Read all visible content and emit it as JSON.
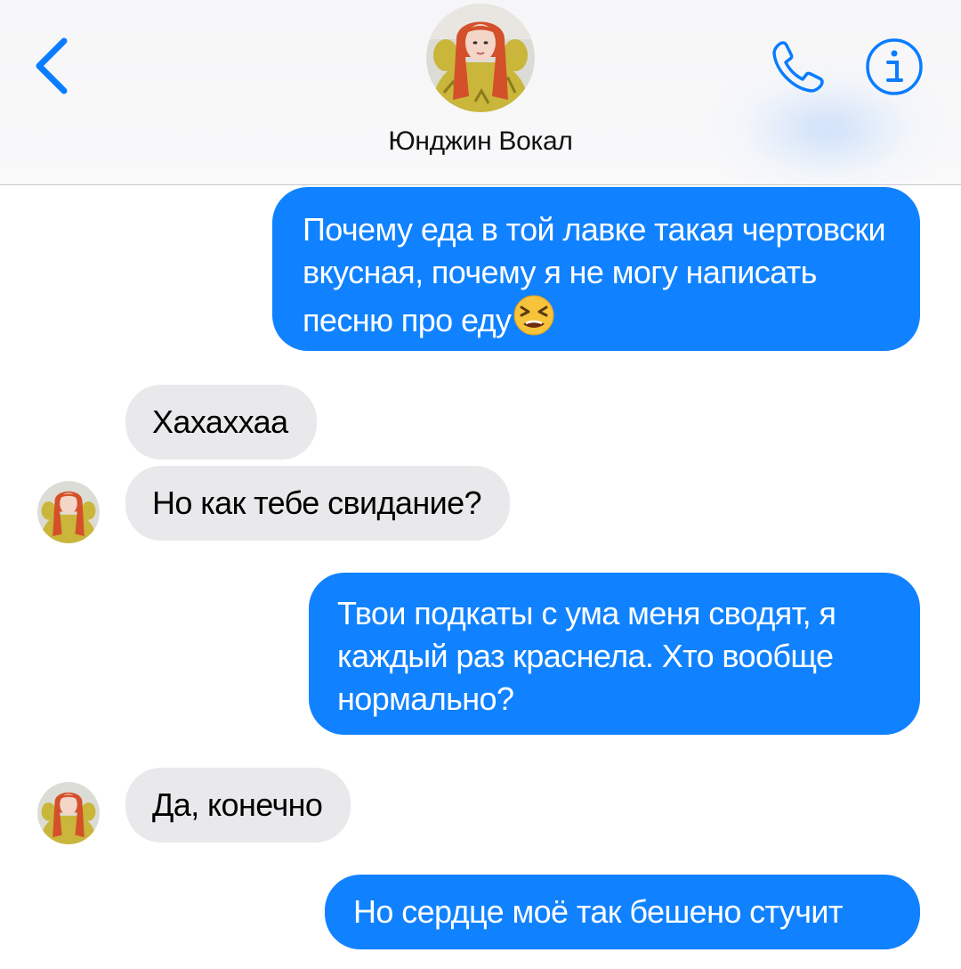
{
  "header": {
    "contact_name": "Юнджин Вокал"
  },
  "messages": [
    {
      "direction": "outgoing",
      "text": "Почему еда в той лавке такая чертовски вкусная, почему я не могу написать песню про еду",
      "emoji": "tired-face-emoji"
    },
    {
      "direction": "incoming",
      "text": "Хахаххаа"
    },
    {
      "direction": "incoming",
      "text": "Но как тебе свидание?"
    },
    {
      "direction": "outgoing",
      "text": "Твои подкаты с ума меня сводят, я каждый раз краснела. Хто вообще нормально?"
    },
    {
      "direction": "incoming",
      "text": "Да, конечно"
    },
    {
      "direction": "outgoing",
      "text": "Но сердце моё так бешено стучит"
    }
  ],
  "colors": {
    "accent": "#0a7cff",
    "outgoing_bubble": "#1082ff",
    "incoming_bubble": "#e9e9eb"
  },
  "icons": [
    "back-chevron-icon",
    "phone-icon",
    "info-icon"
  ]
}
